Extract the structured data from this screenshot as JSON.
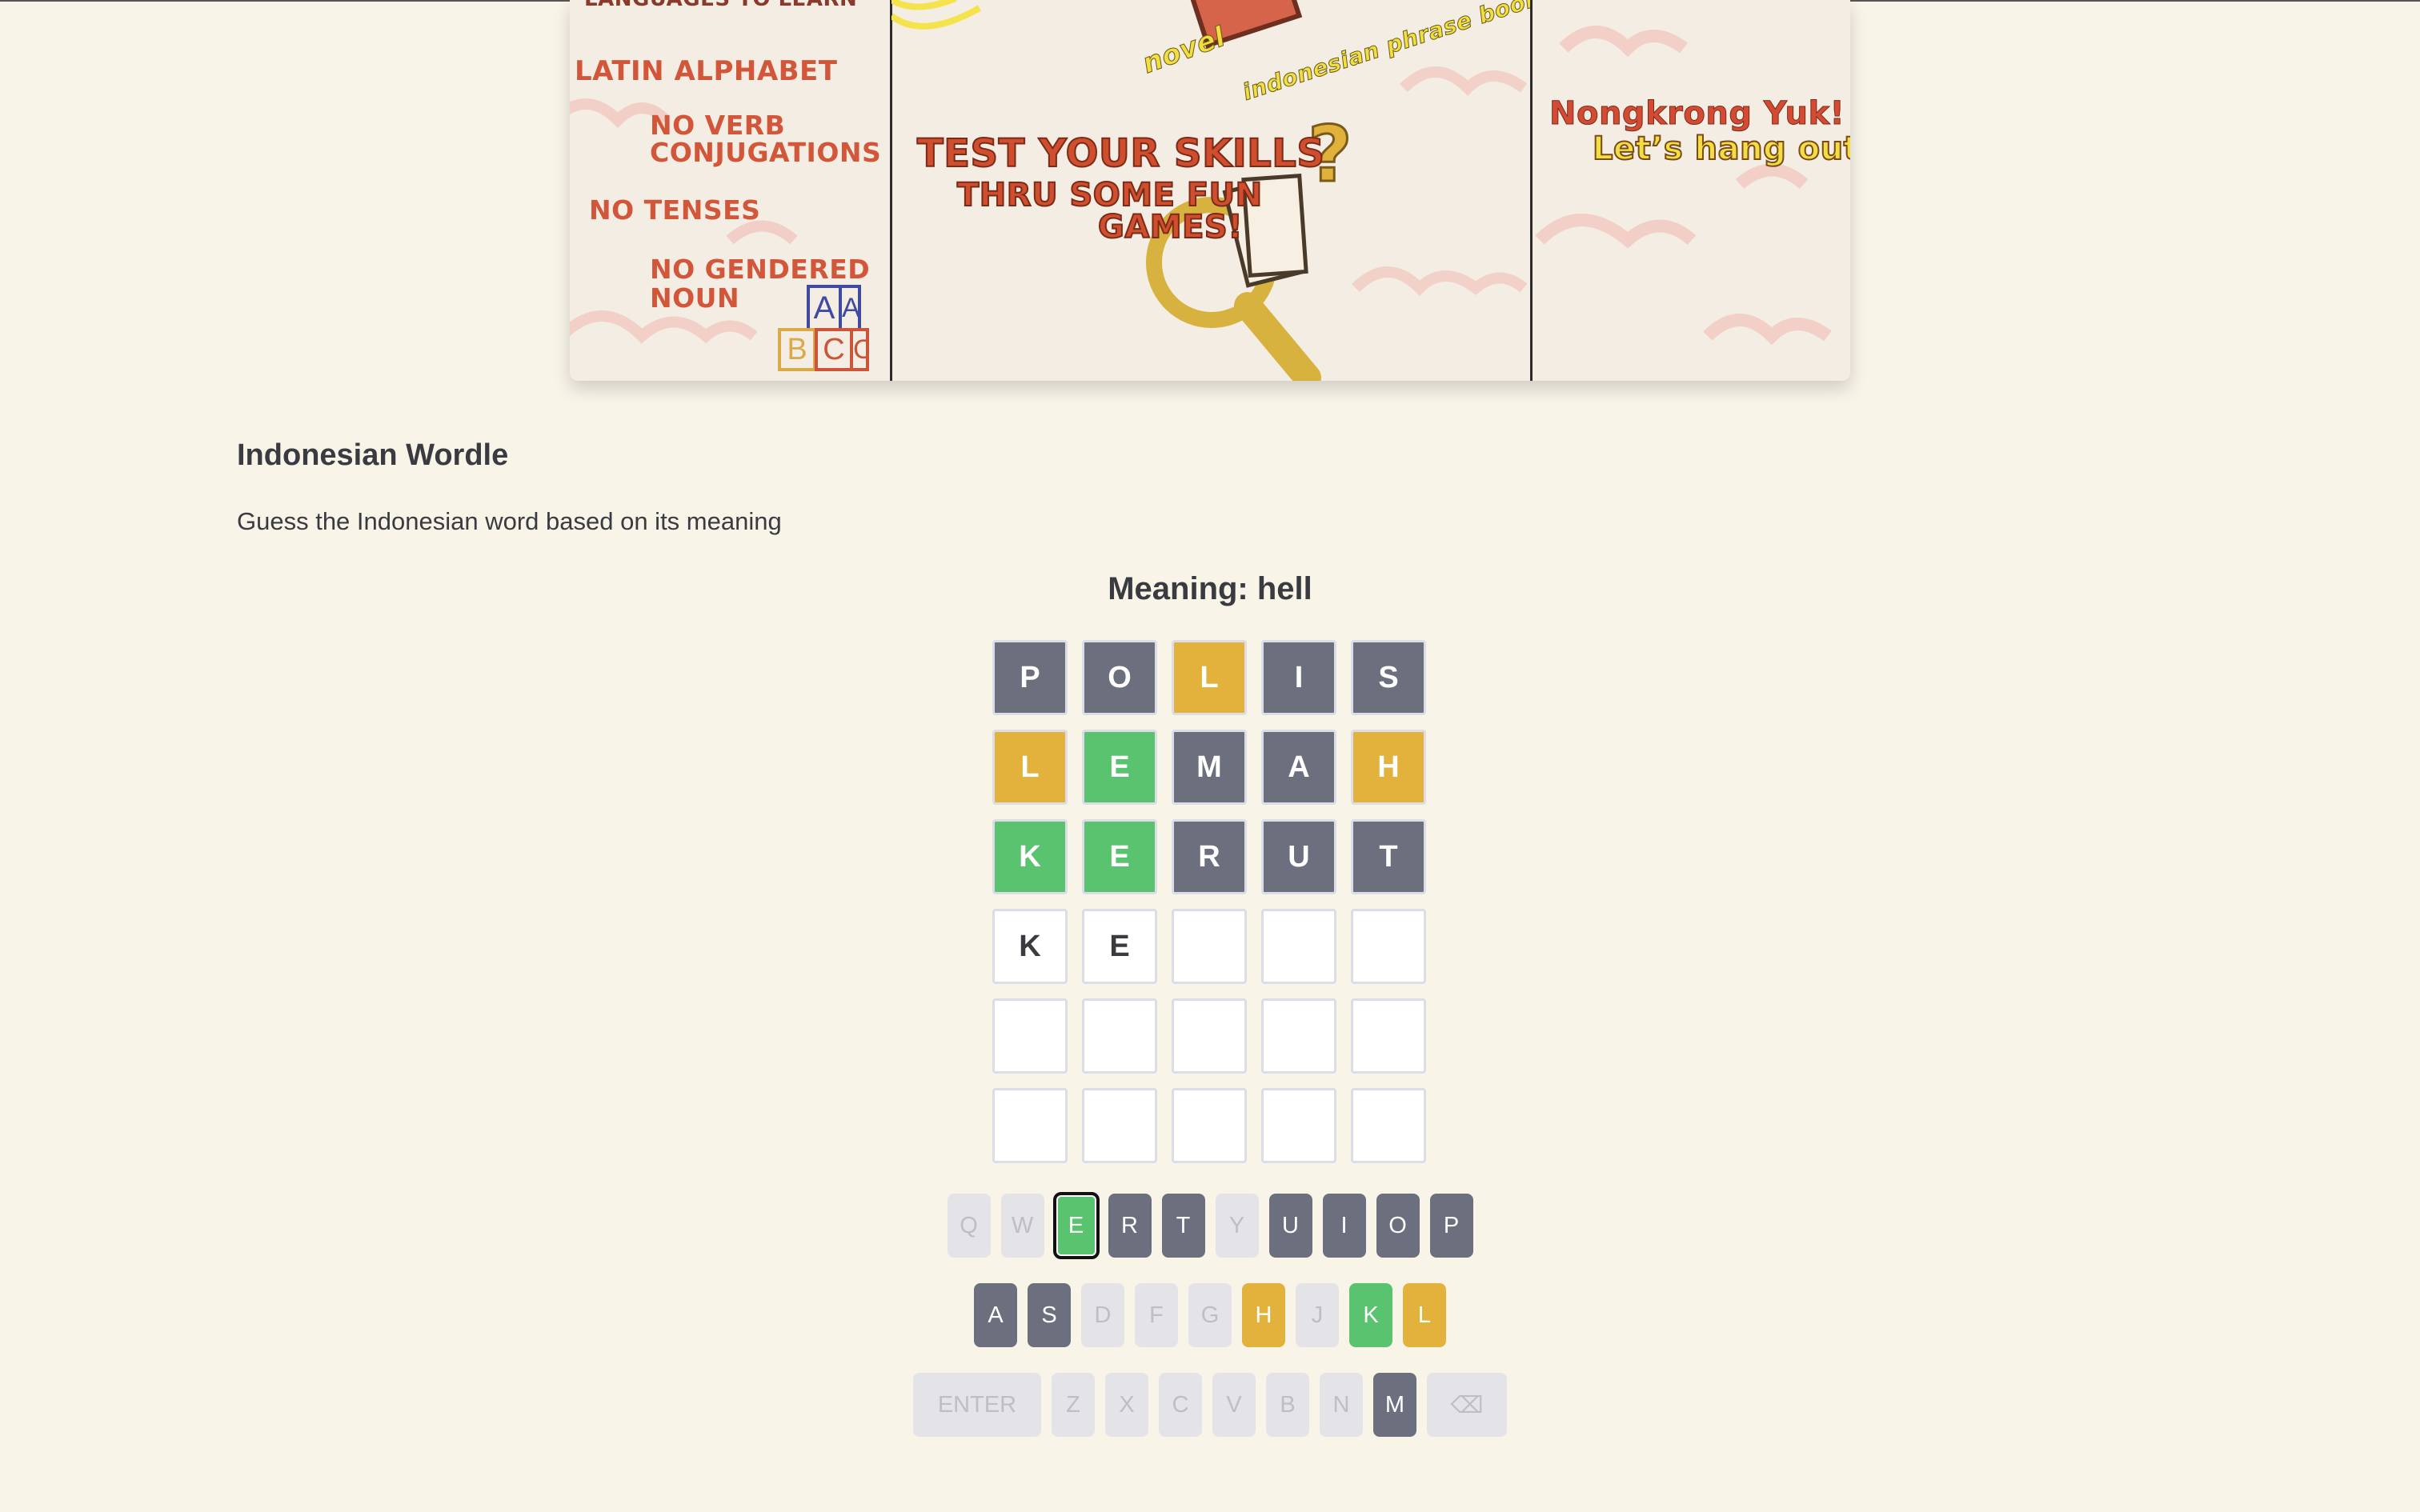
{
  "banner": {
    "panel1": {
      "heading": "LANGUAGES TO LEARN",
      "items": [
        "LATIN ALPHABET",
        "NO VERB",
        "CONJUGATIONS",
        "NO TENSES",
        "NO GENDERED",
        "NOUN"
      ],
      "blocks": [
        "A",
        "A",
        "B",
        "C",
        "C"
      ]
    },
    "panel2": {
      "top_labels": [
        "novel",
        "indonesian phrase books"
      ],
      "headline": [
        "TEST YOUR SKILLS",
        "THRU SOME FUN",
        "GAMES!"
      ]
    },
    "panel3": {
      "line1": "Nongkrong Yuk!",
      "line2": "Let’s hang out!"
    }
  },
  "page": {
    "title": "Indonesian Wordle",
    "subtitle": "Guess the Indonesian word based on its meaning",
    "meaning": "Meaning: hell"
  },
  "board": {
    "rows": [
      [
        {
          "l": "P",
          "s": "absent"
        },
        {
          "l": "O",
          "s": "absent"
        },
        {
          "l": "L",
          "s": "present"
        },
        {
          "l": "I",
          "s": "absent"
        },
        {
          "l": "S",
          "s": "absent"
        }
      ],
      [
        {
          "l": "L",
          "s": "present"
        },
        {
          "l": "E",
          "s": "correct"
        },
        {
          "l": "M",
          "s": "absent"
        },
        {
          "l": "A",
          "s": "absent"
        },
        {
          "l": "H",
          "s": "present"
        }
      ],
      [
        {
          "l": "K",
          "s": "correct"
        },
        {
          "l": "E",
          "s": "correct"
        },
        {
          "l": "R",
          "s": "absent"
        },
        {
          "l": "U",
          "s": "absent"
        },
        {
          "l": "T",
          "s": "absent"
        }
      ],
      [
        {
          "l": "K",
          "s": "typed"
        },
        {
          "l": "E",
          "s": "typed"
        },
        {
          "l": "",
          "s": "empty"
        },
        {
          "l": "",
          "s": "empty"
        },
        {
          "l": "",
          "s": "empty"
        }
      ],
      [
        {
          "l": "",
          "s": "empty"
        },
        {
          "l": "",
          "s": "empty"
        },
        {
          "l": "",
          "s": "empty"
        },
        {
          "l": "",
          "s": "empty"
        },
        {
          "l": "",
          "s": "empty"
        }
      ],
      [
        {
          "l": "",
          "s": "empty"
        },
        {
          "l": "",
          "s": "empty"
        },
        {
          "l": "",
          "s": "empty"
        },
        {
          "l": "",
          "s": "empty"
        },
        {
          "l": "",
          "s": "empty"
        }
      ]
    ]
  },
  "keyboard": {
    "rows": [
      [
        {
          "k": "Q",
          "s": "unused"
        },
        {
          "k": "W",
          "s": "unused"
        },
        {
          "k": "E",
          "s": "correct",
          "focus": true
        },
        {
          "k": "R",
          "s": "absent"
        },
        {
          "k": "T",
          "s": "absent"
        },
        {
          "k": "Y",
          "s": "unused"
        },
        {
          "k": "U",
          "s": "absent"
        },
        {
          "k": "I",
          "s": "absent"
        },
        {
          "k": "O",
          "s": "absent"
        },
        {
          "k": "P",
          "s": "absent"
        }
      ],
      [
        {
          "k": "A",
          "s": "absent"
        },
        {
          "k": "S",
          "s": "absent"
        },
        {
          "k": "D",
          "s": "unused"
        },
        {
          "k": "F",
          "s": "unused"
        },
        {
          "k": "G",
          "s": "unused"
        },
        {
          "k": "H",
          "s": "present"
        },
        {
          "k": "J",
          "s": "unused"
        },
        {
          "k": "K",
          "s": "correct"
        },
        {
          "k": "L",
          "s": "present"
        }
      ],
      [
        {
          "k": "ENTER",
          "s": "unused",
          "type": "enter"
        },
        {
          "k": "Z",
          "s": "unused"
        },
        {
          "k": "X",
          "s": "unused"
        },
        {
          "k": "C",
          "s": "unused"
        },
        {
          "k": "V",
          "s": "unused"
        },
        {
          "k": "B",
          "s": "unused"
        },
        {
          "k": "N",
          "s": "unused"
        },
        {
          "k": "M",
          "s": "absent"
        },
        {
          "k": "⌫",
          "s": "unused",
          "type": "backspace"
        }
      ]
    ]
  },
  "colors": {
    "background": "#f8f4e8",
    "absent": "#6b6f7e",
    "present": "#e3b23c",
    "correct": "#5ac36f",
    "unused_key": "#e3e3e8"
  }
}
